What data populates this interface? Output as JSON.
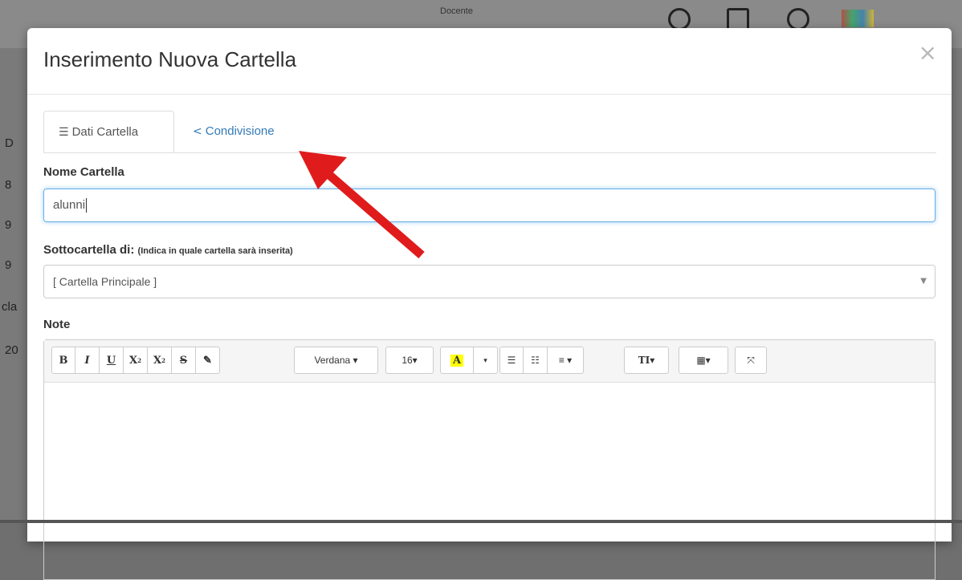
{
  "background": {
    "left_fragments": [
      "D",
      "8",
      "9",
      "9",
      "cla",
      "20"
    ],
    "header_fragments": [
      "Docente"
    ]
  },
  "modal": {
    "title": "Inserimento Nuova Cartella",
    "close_label": "×",
    "tabs": [
      {
        "label": "Dati Cartella",
        "icon": "align-left-icon",
        "active": true
      },
      {
        "label": "Condivisione",
        "icon": "share-icon",
        "active": false
      }
    ],
    "fields": {
      "nome_label": "Nome Cartella",
      "nome_value": "alunni",
      "sotto_label": "Sottocartella di:",
      "sotto_hint": "(Indica in quale cartella sarà inserita)",
      "sotto_value": "[ Cartella Principale ]",
      "note_label": "Note"
    },
    "toolbar": {
      "bold": "B",
      "italic": "I",
      "underline": "U",
      "superscript": "X",
      "subscript": "X",
      "strike": "S",
      "eraser": "✎",
      "font_family": "Verdana ▾",
      "font_size": "16▾",
      "color": "A",
      "color_caret": "▾",
      "ul": "☰",
      "ol": "☷",
      "align": "≡ ▾",
      "height": "TI▾",
      "table": "▦▾",
      "fullscreen": "⤧"
    }
  },
  "colors": {
    "accent": "#337ab7",
    "arrow": "#e01b1b",
    "highlight": "#ffff00"
  }
}
